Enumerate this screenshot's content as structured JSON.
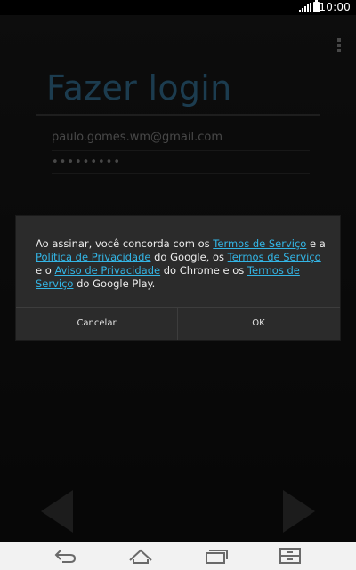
{
  "status_bar": {
    "time": "10:00",
    "icons": [
      "signal-icon",
      "battery-icon"
    ]
  },
  "login": {
    "title": "Fazer login",
    "email": "paulo.gomes.wm@gmail.com",
    "password": "•••••••••"
  },
  "dialog": {
    "text_1": "Ao assinar, você concorda com os ",
    "link_1": "Termos de Serviço",
    "text_2": " e a ",
    "link_2": "Política de Privacidade",
    "text_3": " do Google, os ",
    "link_3": " Termos de Serviço ",
    "text_4": " e o ",
    "link_4": " Aviso de Privacidade",
    "text_5": " do Chrome e os ",
    "link_5": "Termos de Serviço",
    "text_6": " do Google Play.",
    "cancel_label": "Cancelar",
    "ok_label": "OK",
    "link_color": "#33b5e5"
  },
  "navigation": {
    "icons": [
      "back-icon",
      "home-icon",
      "recent-apps-icon",
      "menu-icon"
    ]
  },
  "colors": {
    "title": "#2b5d7a",
    "dialog_bg": "#2b2b2b",
    "nav_bar_bg": "#f2f2f2"
  }
}
